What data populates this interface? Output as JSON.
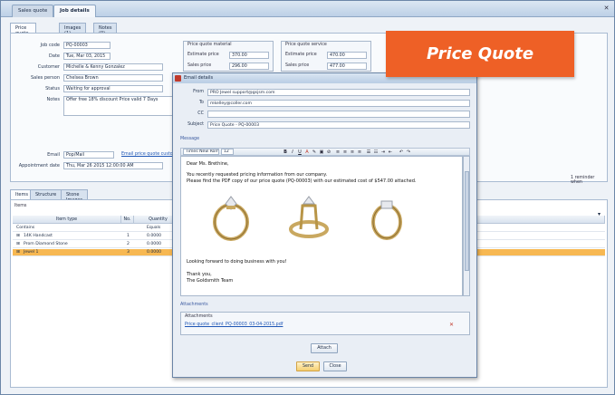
{
  "banner": {
    "text": "Price Quote"
  },
  "window": {
    "tabs": [
      {
        "label": "Sales quote"
      },
      {
        "label": "Job details"
      }
    ],
    "sub_tabs": [
      {
        "label": "Price quote details"
      },
      {
        "label": "Images (1)"
      },
      {
        "label": "Notes (0)"
      }
    ]
  },
  "form": {
    "job_code_label": "Job code",
    "job_code": "PQ-00003",
    "date_label": "Date",
    "date": "Tue, Mar 03, 2015",
    "customer_label": "Customer",
    "customer": "Michelle & Kenny Gonzalez",
    "sales_person_label": "Sales person",
    "sales_person": "Chelsea Brown",
    "status_label": "Status",
    "status": "Waiting for approval",
    "notes_label": "Notes",
    "notes": "Offer free 18% discount Price valid 7 Days",
    "price_group1_title": "Price quote material",
    "price_group2_title": "Price quote service",
    "estimate_price_label": "Estimate price",
    "estimate_price1": "370.00",
    "estimate_price2": "470.00",
    "sales_price_label": "Sales price",
    "sales_price1": "296.00",
    "sales_price2": "477.00",
    "email_label": "Email",
    "email": "Pop/Mail",
    "email_link": "Email price quote custo...",
    "appointment_label": "Appointment date",
    "appointment": "Thu, Mar 26 2015 12:00:00 AM",
    "reminder": "1 reminder when"
  },
  "lower": {
    "tabs": [
      {
        "label": "Items"
      },
      {
        "label": "Structure"
      },
      {
        "label": "Stone Images"
      }
    ],
    "section_label": "Items",
    "columns": [
      "Item type",
      "No.",
      "Quantity",
      "Attributes"
    ],
    "filter_row": {
      "name": "Contains",
      "qty": "Equals"
    },
    "rows": [
      {
        "name": "14K Handcast",
        "no": "1",
        "qty": "0.0000"
      },
      {
        "name": "Prom Diamond Stone",
        "no": "2",
        "qty": "0.0000"
      },
      {
        "name": "Jewel 1",
        "no": "3",
        "qty": "0.0000"
      }
    ]
  },
  "dialog": {
    "title": "Email details",
    "from_label": "From",
    "from": "PRO Jewel support@gsjsm.com",
    "to_label": "To",
    "to": "mkelley@coller.com",
    "cc_label": "CC",
    "cc": "",
    "subject_label": "Subject",
    "subject": "Price Quote - PQ-00003",
    "message_label": "Message",
    "font_name": "Times New Roman",
    "font_size": "12",
    "body": {
      "greeting": "Dear Ms. Brethine,",
      "line1": "You recently requested pricing information from our company.",
      "line2": "Please find the PDF copy of our price quote (PQ-00003) with our estimated cost of $547.00 attached.",
      "line3": "Looking forward to doing business with you!",
      "closing1": "Thank you,",
      "closing2": "The Goldsmith Team"
    },
    "attachments_label": "Attachments",
    "attachments_group": "Attachments",
    "attachment_file": "Price quote_client_PQ-00003_03-04-2015.pdf",
    "attach_button": "Attach",
    "send_button": "Send",
    "close_button": "Close"
  },
  "colors": {
    "banner": "#ee6026",
    "selection": "#f7b852",
    "link": "#1e56b5"
  }
}
